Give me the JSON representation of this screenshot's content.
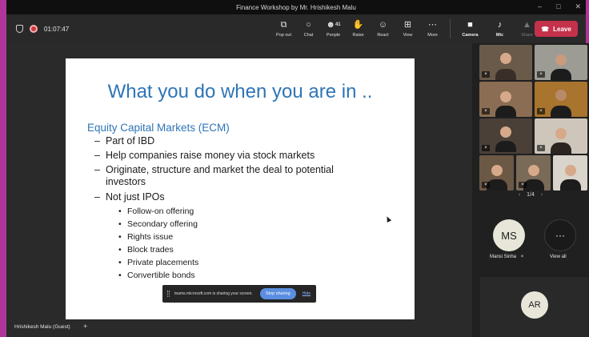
{
  "window": {
    "title": "Finance Workshop by Mr. Hrishikesh Malu"
  },
  "call": {
    "timer": "01:07:47"
  },
  "toolbar": {
    "pop_out": "Pop out",
    "chat": "Chat",
    "people": "People",
    "people_count": "41",
    "raise": "Raise",
    "react": "React",
    "view": "View",
    "more": "More",
    "camera": "Camera",
    "mic": "Mic",
    "share": "Share",
    "leave": "Leave"
  },
  "slide": {
    "title": "What you do when you are in ..",
    "heading": "Equity Capital Markets (ECM)",
    "level1": [
      "Part of IBD",
      "Help companies raise money via stock markets",
      "Originate, structure and market the deal to potential",
      "investors",
      "Not just IPOs"
    ],
    "level2": [
      "Follow-on offering",
      "Secondary offering",
      "Rights issue",
      "Block trades",
      "Private placements",
      "Convertible bonds"
    ]
  },
  "share_bar": {
    "message": "teams.microsoft.com is sharing your screen.",
    "stop": "Stop sharing",
    "hide": "Hide"
  },
  "presenter": {
    "name": "Hrishikesh Malu (Guest)"
  },
  "gallery": {
    "pager": "1/4",
    "participant_initials": "MS",
    "participant_name": "Mansi Sinha",
    "view_all": "View all",
    "view_all_glyph": "···",
    "tile_initials": "AR"
  },
  "colors": {
    "accent": "#2e75b6",
    "leave": "#c4314b",
    "border": "#b0359a",
    "stop_sharing": "#5b8ee0"
  }
}
